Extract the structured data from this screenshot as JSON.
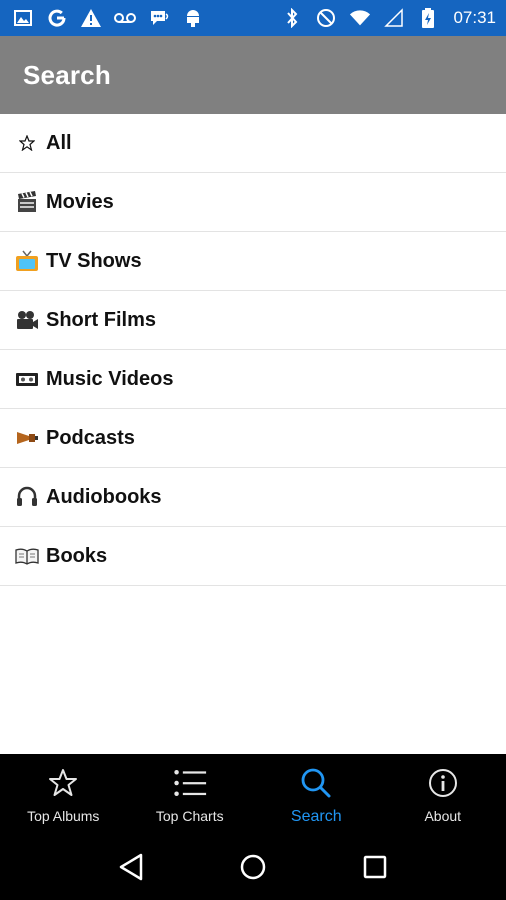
{
  "status_bar": {
    "time": "07:31",
    "background": "#1565c0",
    "left_icons": [
      "image-icon",
      "google-icon",
      "warning-icon",
      "voicemail-icon",
      "chat-icon",
      "android-icon"
    ],
    "right_icons": [
      "bluetooth-icon",
      "do-not-disturb-icon",
      "wifi-icon",
      "signal-icon",
      "battery-icon"
    ]
  },
  "app_bar": {
    "title": "Search",
    "background": "#808080"
  },
  "categories": [
    {
      "label": "All",
      "icon": "star-icon"
    },
    {
      "label": "Movies",
      "icon": "clapperboard-icon"
    },
    {
      "label": "TV Shows",
      "icon": "tv-icon"
    },
    {
      "label": "Short Films",
      "icon": "movie-camera-icon"
    },
    {
      "label": "Music Videos",
      "icon": "videotape-icon"
    },
    {
      "label": "Podcasts",
      "icon": "gramophone-icon"
    },
    {
      "label": "Audiobooks",
      "icon": "headphones-icon"
    },
    {
      "label": "Books",
      "icon": "open-book-icon"
    }
  ],
  "bottom_nav": {
    "active": "Search",
    "active_color": "#2196f3",
    "items": [
      {
        "label": "Top Albums",
        "icon": "star-outline-icon"
      },
      {
        "label": "Top Charts",
        "icon": "list-icon"
      },
      {
        "label": "Search",
        "icon": "search-icon"
      },
      {
        "label": "About",
        "icon": "info-icon"
      }
    ]
  },
  "system_nav": [
    "back-icon",
    "home-icon",
    "recents-icon"
  ]
}
